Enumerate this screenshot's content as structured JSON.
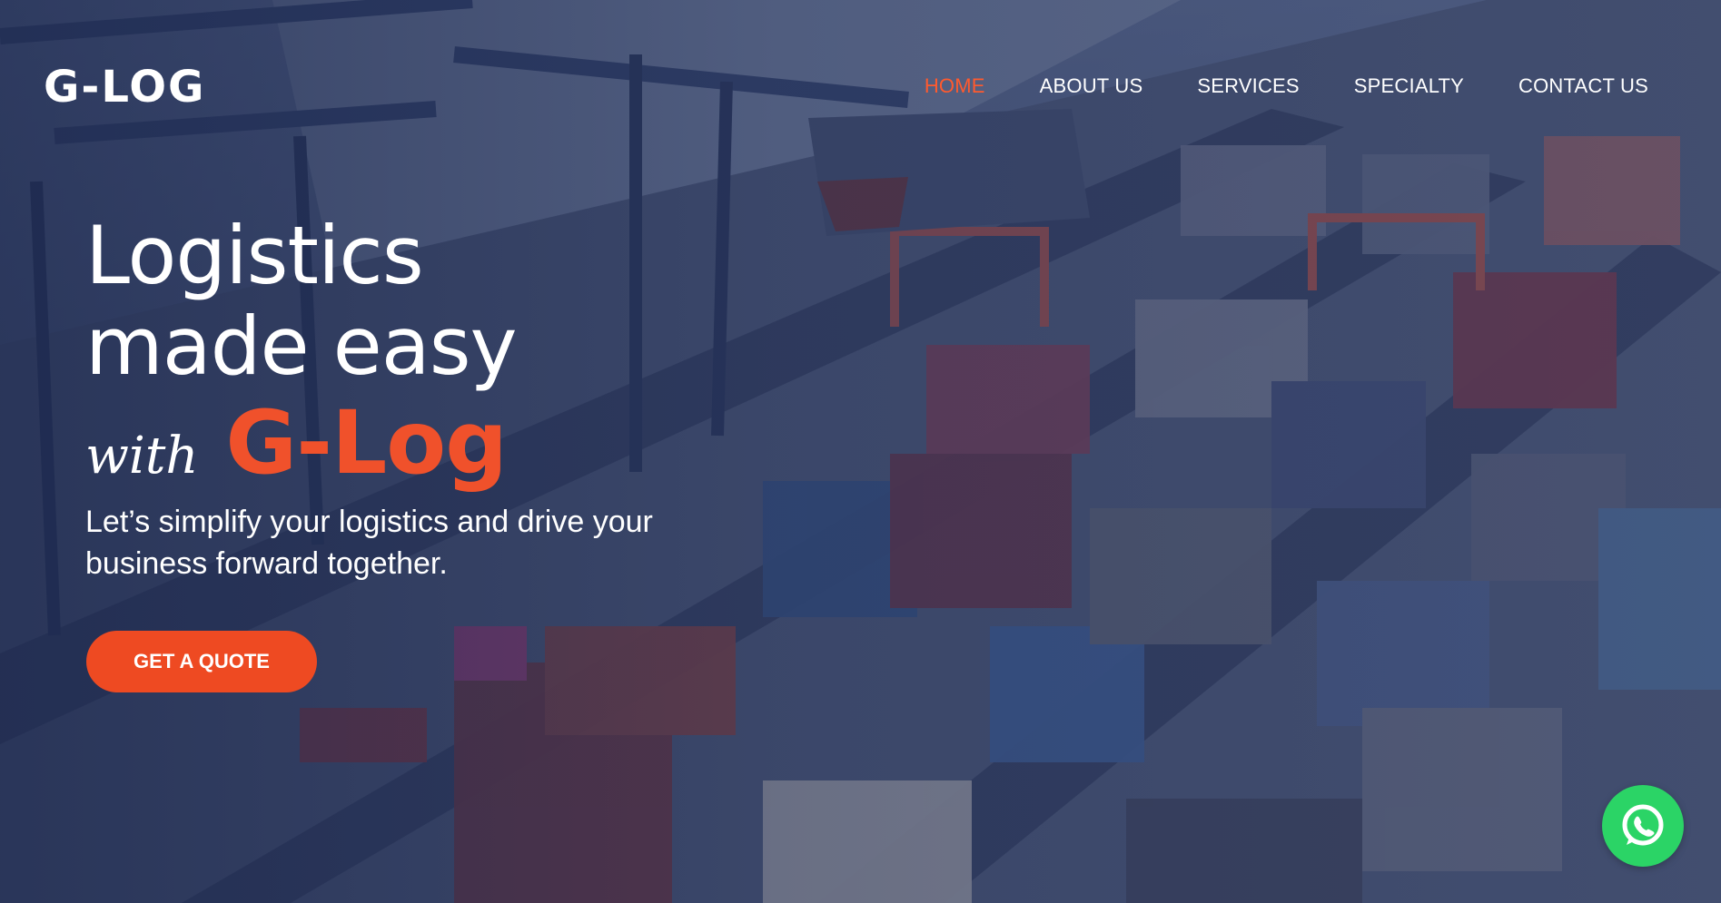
{
  "brand": {
    "logo_text": "G-LOG",
    "accent_color": "#f0512b"
  },
  "nav": {
    "items": [
      {
        "label": "HOME",
        "active": true
      },
      {
        "label": "ABOUT US",
        "active": false
      },
      {
        "label": "SERVICES",
        "active": false
      },
      {
        "label": "SPECIALTY",
        "active": false
      },
      {
        "label": "CONTACT US",
        "active": false
      }
    ]
  },
  "hero": {
    "headline_line1": "Logistics",
    "headline_line2": "made easy",
    "with_word": "with",
    "brand_word": "G-Log",
    "subtitle": "Let’s simplify your logistics and drive your business forward together.",
    "cta_label": "GET A QUOTE",
    "background": "container-port-aerial"
  },
  "floating": {
    "whatsapp_icon": "whatsapp-icon",
    "whatsapp_color": "#2bd466"
  }
}
